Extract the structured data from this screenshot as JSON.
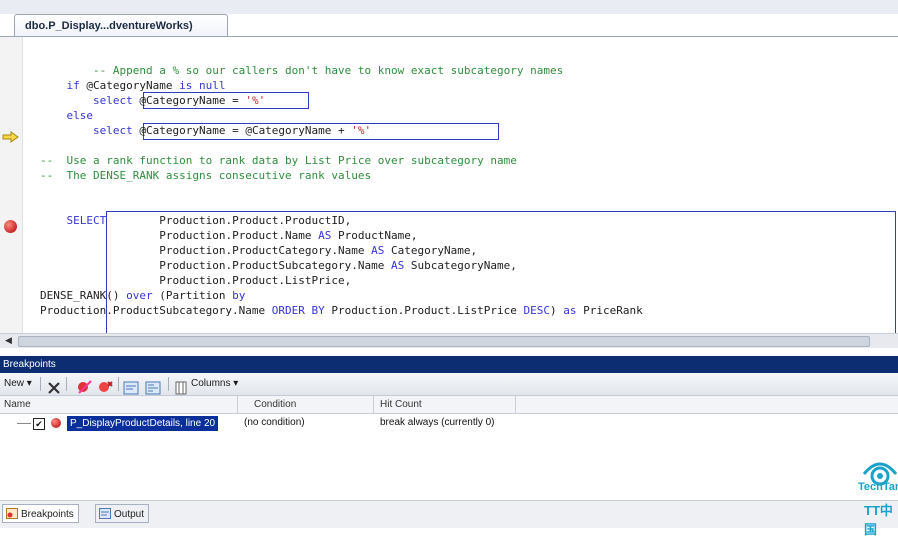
{
  "document_tab": {
    "title": "dbo.P_Display...dventureWorks)"
  },
  "editor": {
    "lines": [
      {
        "indent": "        ",
        "parts": [
          {
            "cls": "cm",
            "text": "-- Append a % so our callers don't have to know exact subcategory names"
          }
        ]
      },
      {
        "indent": "    ",
        "parts": [
          {
            "cls": "kw",
            "text": "if"
          },
          {
            "cls": "",
            "text": " @CategoryName "
          },
          {
            "cls": "kw",
            "text": "is null"
          }
        ]
      },
      {
        "indent": "        ",
        "parts": [
          {
            "cls": "kw",
            "text": "select"
          },
          {
            "cls": "",
            "text": " @CategoryName = "
          },
          {
            "cls": "st",
            "text": "'%'"
          }
        ]
      },
      {
        "indent": "    ",
        "parts": [
          {
            "cls": "kw",
            "text": "else"
          }
        ]
      },
      {
        "indent": "        ",
        "parts": [
          {
            "cls": "kw",
            "text": "select"
          },
          {
            "cls": "",
            "text": " @CategoryName = @CategoryName + "
          },
          {
            "cls": "st",
            "text": "'%'"
          }
        ]
      },
      {
        "indent": "",
        "parts": []
      },
      {
        "indent": "",
        "parts": [
          {
            "cls": "cm",
            "text": "--  Use a rank function to rank data by List Price over subcategory name"
          }
        ]
      },
      {
        "indent": "",
        "parts": [
          {
            "cls": "cm",
            "text": "--  The DENSE_RANK assigns consecutive rank values"
          }
        ]
      },
      {
        "indent": "",
        "parts": []
      },
      {
        "indent": "",
        "parts": []
      },
      {
        "indent": "    ",
        "parts": [
          {
            "cls": "kw",
            "text": "SELECT"
          },
          {
            "cls": "",
            "text": "        Production.Product.ProductID,"
          }
        ]
      },
      {
        "indent": "                  ",
        "parts": [
          {
            "cls": "",
            "text": "Production.Product.Name "
          },
          {
            "cls": "kw",
            "text": "AS"
          },
          {
            "cls": "",
            "text": " ProductName,"
          }
        ]
      },
      {
        "indent": "                  ",
        "parts": [
          {
            "cls": "",
            "text": "Production.ProductCategory.Name "
          },
          {
            "cls": "kw",
            "text": "AS"
          },
          {
            "cls": "",
            "text": " CategoryName,"
          }
        ]
      },
      {
        "indent": "                  ",
        "parts": [
          {
            "cls": "",
            "text": "Production.ProductSubcategory.Name "
          },
          {
            "cls": "kw",
            "text": "AS"
          },
          {
            "cls": "",
            "text": " SubcategoryName,"
          }
        ]
      },
      {
        "indent": "                  ",
        "parts": [
          {
            "cls": "",
            "text": "Production.Product.ListPrice,"
          }
        ]
      },
      {
        "indent": "",
        "parts": [
          {
            "cls": "",
            "text": "DENSE_RANK() "
          },
          {
            "cls": "kw",
            "text": "over"
          },
          {
            "cls": "",
            "text": " (Partition "
          },
          {
            "cls": "kw",
            "text": "by"
          }
        ]
      },
      {
        "indent": "",
        "parts": [
          {
            "cls": "",
            "text": "Production.ProductSubcategory.Name "
          },
          {
            "cls": "kw",
            "text": "ORDER BY"
          },
          {
            "cls": "",
            "text": " Production.Product.ListPrice "
          },
          {
            "cls": "kw",
            "text": "DESC"
          },
          {
            "cls": "",
            "text": ") "
          },
          {
            "cls": "kw",
            "text": "as"
          },
          {
            "cls": "",
            "text": " PriceRank"
          }
        ]
      }
    ]
  },
  "breakpoints_panel": {
    "title": "Breakpoints",
    "toolbar": {
      "new_label": "New",
      "columns_label": "Columns"
    },
    "columns": {
      "name": "Name",
      "condition": "Condition",
      "hit_count": "Hit Count"
    },
    "rows": [
      {
        "name": "P_DisplayProductDetails, line 20",
        "condition": "(no condition)",
        "hit_count": "break always (currently 0)",
        "checked": true
      }
    ]
  },
  "bottom_tabs": [
    "Breakpoints",
    "Output"
  ],
  "watermark": {
    "line1": "TechTarge",
    "line2": "TT中国"
  },
  "colors": {
    "accent": "#0c2d72",
    "comment": "#2f8f3d",
    "keyword": "#3434d8",
    "string": "#c02020"
  }
}
